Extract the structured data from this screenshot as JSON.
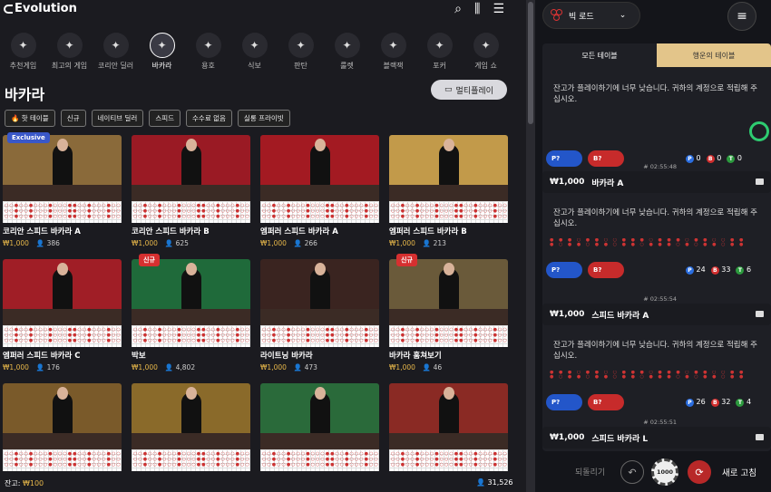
{
  "header": {
    "logo": "Evolution"
  },
  "categories": [
    {
      "label": "추천게임",
      "icon": "sparkle-icon"
    },
    {
      "label": "최고의 게임",
      "icon": "podium-icon"
    },
    {
      "label": "코리안 딜러",
      "icon": "won-chip-icon"
    },
    {
      "label": "바카라",
      "icon": "baccarat-icon",
      "active": true
    },
    {
      "label": "용호",
      "icon": "dragon-icon"
    },
    {
      "label": "식보",
      "icon": "dice-icon"
    },
    {
      "label": "판탄",
      "icon": "fantan-icon"
    },
    {
      "label": "룰렛",
      "icon": "roulette-icon"
    },
    {
      "label": "블랙잭",
      "icon": "cards-icon"
    },
    {
      "label": "포커",
      "icon": "poker-icon"
    },
    {
      "label": "게임 쇼",
      "icon": "gameshow-icon"
    }
  ],
  "page": {
    "title": "바카라",
    "multiplay": "멀티플레이"
  },
  "filters": [
    "🔥 핫 테이블",
    "신규",
    "네이티브 딜러",
    "스피드",
    "수수료 없음",
    "실롱 프라이빗"
  ],
  "cards": [
    {
      "name": "코리안 스피드 바카라 A",
      "bet": "₩1,000",
      "players": "386",
      "badge": "Exclusive",
      "bg": "#8a6a3a"
    },
    {
      "name": "코리안 스피드 바카라 B",
      "bet": "₩1,000",
      "players": "625",
      "badge": "",
      "bg": "#9a1a24"
    },
    {
      "name": "엠퍼러 스피드 바카라 A",
      "bet": "₩1,000",
      "players": "266",
      "badge": "",
      "bg": "#a31a22"
    },
    {
      "name": "엠퍼러 스피드 바카라 B",
      "bet": "₩1,000",
      "players": "213",
      "badge": "",
      "bg": "#c29a4a"
    },
    {
      "name": "엠퍼러 스피드 바카라 C",
      "bet": "₩1,000",
      "players": "176",
      "badge": "",
      "bg": "#a01e26"
    },
    {
      "name": "박보",
      "bet": "₩1,000",
      "players": "4,802",
      "badge": "신규",
      "bg": "#1f6a3a"
    },
    {
      "name": "라이트닝 바카라",
      "bet": "₩1,000",
      "players": "473",
      "badge": "",
      "bg": "#3a2420"
    },
    {
      "name": "바카라 훔쳐보기",
      "bet": "₩1,000",
      "players": "46",
      "badge": "신규",
      "bg": "#6a5a3a"
    },
    {
      "name": "",
      "bet": "",
      "players": "",
      "badge": "",
      "bg": "#7a5a2a"
    },
    {
      "name": "",
      "bet": "",
      "players": "",
      "badge": "",
      "bg": "#8a6a2a"
    },
    {
      "name": "",
      "bet": "",
      "players": "",
      "badge": "",
      "bg": "#2a6a3a"
    },
    {
      "name": "",
      "bet": "",
      "players": "",
      "badge": "",
      "bg": "#8a2a24"
    }
  ],
  "footer": {
    "balance_label": "잔고:",
    "balance": "₩100",
    "players_total": "31,526"
  },
  "right": {
    "selector": "빅 로드",
    "tabs": [
      "모든 테이블",
      "행운의 테이블"
    ],
    "warning": "잔고가 플레이하기에 너무 낮습니다. 귀하의 계정으로 적립해 주십시오.",
    "top": {
      "p_chip": "P?",
      "b_chip": "B?",
      "p": "0",
      "b": "0",
      "t": "0"
    },
    "tables": [
      {
        "bet": "₩1,000",
        "name": "바카라 A",
        "time": "# 02:55:48",
        "p": "24",
        "b": "33",
        "t": "6"
      },
      {
        "bet": "₩1,000",
        "name": "스피드 바카라 A",
        "time": "# 02:55:54",
        "p": "26",
        "b": "32",
        "t": "4"
      },
      {
        "bet": "₩1,000",
        "name": "스피드 바카라 L",
        "time": "# 02:55:51"
      }
    ],
    "chips": {
      "p": "P?",
      "b": "B?"
    },
    "foot": {
      "undo": "되돌리기",
      "coin": "1000",
      "refresh": "새로 고침"
    }
  }
}
